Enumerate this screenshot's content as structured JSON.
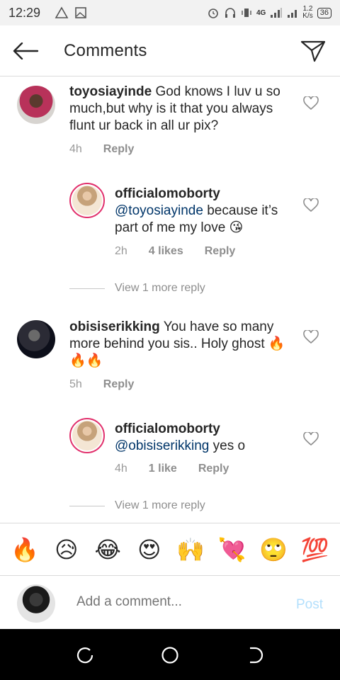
{
  "status_bar": {
    "time": "12:29",
    "network": "4G",
    "speed_value": "1.2",
    "speed_unit": "K/s",
    "battery": "36"
  },
  "header": {
    "title": "Comments"
  },
  "comments": [
    {
      "username": "toyosiayinde",
      "text": "God knows I luv u so much,but why is it that you always flunt ur back in all ur pix?",
      "time": "4h",
      "reply_label": "Reply",
      "replies": [
        {
          "username": "officialomoborty",
          "mention": "@toyosiayinde",
          "text": " because it’s part of me my love 😘",
          "time": "2h",
          "likes": "4 likes",
          "reply_label": "Reply"
        }
      ],
      "view_more": "View 1 more reply"
    },
    {
      "username": "obisiserikking",
      "text": "You have so many more behind you sis.. Holy ghost 🔥🔥🔥",
      "time": "5h",
      "reply_label": "Reply",
      "replies": [
        {
          "username": "officialomoborty",
          "mention": "@obisiserikking",
          "text": " yes o",
          "time": "4h",
          "likes": "1 like",
          "reply_label": "Reply"
        }
      ],
      "view_more": "View 1 more reply"
    }
  ],
  "emoji_bar": [
    "🔥",
    "😥",
    "😂",
    "😍",
    "🙌",
    "💘",
    "🙄",
    "💯"
  ],
  "add_comment": {
    "placeholder": "Add a comment...",
    "post_label": "Post"
  },
  "colors": {
    "mention": "#003569",
    "post_disabled": "#b2dffc",
    "meta": "#8e8e8e",
    "story_ring": "#e1306c"
  }
}
